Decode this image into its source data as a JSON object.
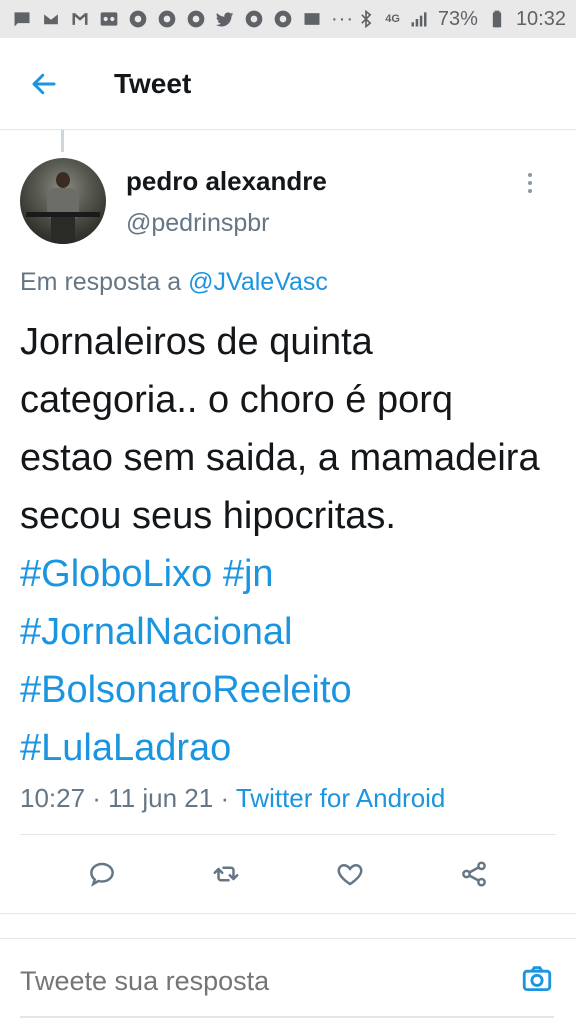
{
  "status_bar": {
    "network": "4G",
    "battery": "73%",
    "time": "10:32",
    "dots": "···",
    "icons": [
      "message-icon",
      "email-icon",
      "gmail-icon",
      "voicemail-icon",
      "chrome-icon",
      "chrome-icon",
      "chrome-icon",
      "twitter-icon",
      "chrome-icon",
      "chrome-icon",
      "email-icon",
      "bluetooth-icon",
      "signal-icon",
      "battery-icon"
    ]
  },
  "header": {
    "title": "Tweet",
    "back_icon": "arrow-left-icon"
  },
  "tweet": {
    "author_name": "pedro alexandre",
    "author_handle": "@pedrinspbr",
    "reply_prefix": "Em resposta a ",
    "reply_mention": "@JValeVasc",
    "text_plain": "Jornaleiros de quinta categoria.. o choro é porq estao sem saida, a mamadeira secou seus hipocritas. ",
    "hashtags": [
      "#GloboLixo",
      "#jn",
      "#JornalNacional",
      "#BolsonaroReeleito",
      "#LulaLadrao"
    ],
    "timestamp": "10:27 · 11 jun 21 · ",
    "source": "Twitter for Android"
  },
  "actions": {
    "reply_icon": "comment-icon",
    "retweet_icon": "retweet-icon",
    "like_icon": "heart-icon",
    "share_icon": "share-icon"
  },
  "reply_bar": {
    "placeholder": "Tweete sua resposta",
    "camera_icon": "camera-icon"
  },
  "colors": {
    "accent": "#1b95e0",
    "text": "#14171a",
    "secondary": "#657786",
    "status_bar_bg": "#e9e9e9"
  }
}
